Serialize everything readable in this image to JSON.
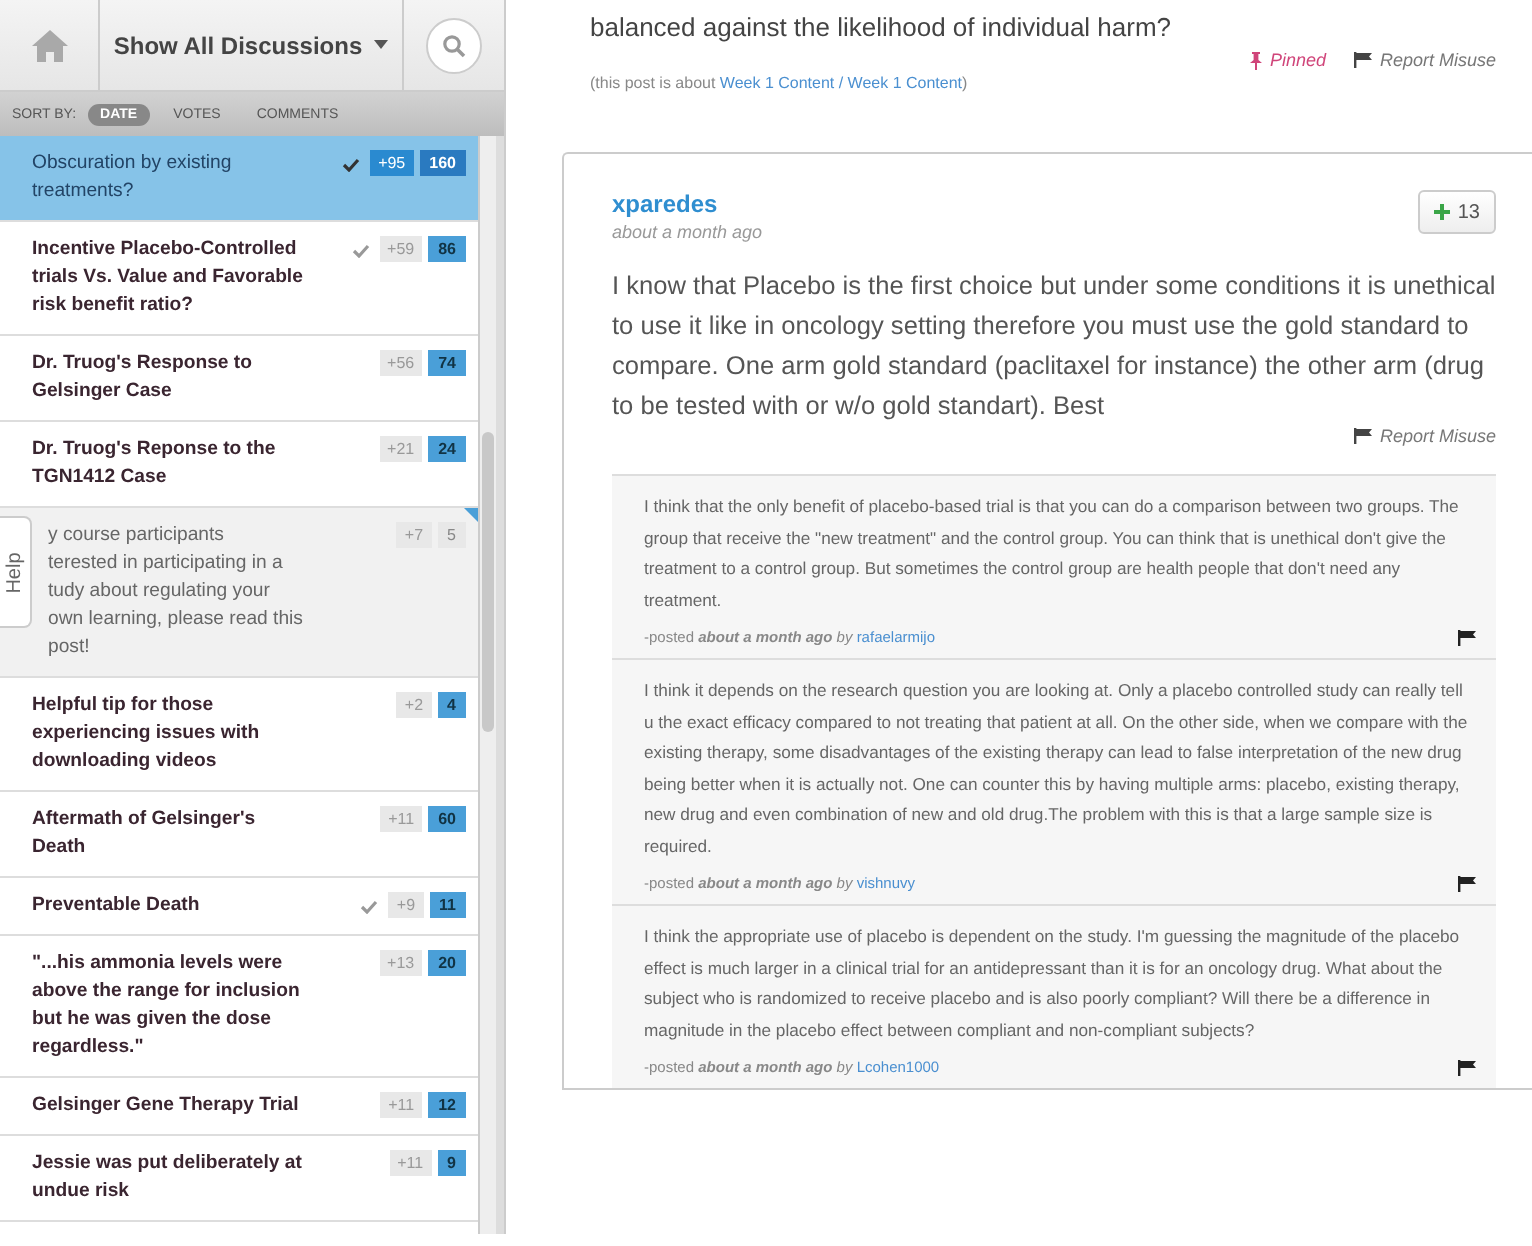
{
  "sidebar": {
    "filter_label": "Show All Discussions",
    "sort_label": "SORT BY:",
    "sort_options": [
      {
        "label": "DATE",
        "selected": true
      },
      {
        "label": "VOTES",
        "selected": false
      },
      {
        "label": "COMMENTS",
        "selected": false
      }
    ],
    "threads": [
      {
        "lines": [
          "Obscuration by existing",
          "treatments?"
        ],
        "followed": true,
        "votes": "+95",
        "comments": "160",
        "selected": true,
        "unread": false
      },
      {
        "lines": [
          "Incentive Placebo-Controlled",
          "trials Vs. Value and Favorable",
          "risk benefit ratio?"
        ],
        "followed": true,
        "votes": "+59",
        "comments": "86",
        "selected": false,
        "unread": false
      },
      {
        "lines": [
          "Dr. Truog's Response to",
          "Gelsinger Case"
        ],
        "followed": false,
        "votes": "+56",
        "comments": "74",
        "selected": false,
        "unread": false
      },
      {
        "lines": [
          "Dr. Truog's Reponse to the",
          "TGN1412 Case"
        ],
        "followed": false,
        "votes": "+21",
        "comments": "24",
        "selected": false,
        "unread": false
      },
      {
        "lines": [
          "y course participants",
          "terested in participating in a",
          "tudy about regulating your",
          "own learning, please read this",
          "post!"
        ],
        "followed": false,
        "votes": "+7",
        "comments": "5",
        "selected": false,
        "unread": true
      },
      {
        "lines": [
          "Helpful tip for those",
          "experiencing issues with",
          "downloading videos"
        ],
        "followed": false,
        "votes": "+2",
        "comments": "4",
        "selected": false,
        "unread": false
      },
      {
        "lines": [
          "Aftermath of Gelsinger's",
          "Death"
        ],
        "followed": false,
        "votes": "+11",
        "comments": "60",
        "selected": false,
        "unread": false
      },
      {
        "lines": [
          "Preventable Death"
        ],
        "followed": true,
        "votes": "+9",
        "comments": "11",
        "selected": false,
        "unread": false
      },
      {
        "lines": [
          "\"...his ammonia levels were",
          "above the range for inclusion",
          "but he was given the dose",
          "regardless.\""
        ],
        "followed": false,
        "votes": "+13",
        "comments": "20",
        "selected": false,
        "unread": false
      },
      {
        "lines": [
          "Gelsinger Gene Therapy Trial"
        ],
        "followed": false,
        "votes": "+11",
        "comments": "12",
        "selected": false,
        "unread": false
      },
      {
        "lines": [
          "Jessie was put deliberately at",
          "undue risk"
        ],
        "followed": false,
        "votes": "+11",
        "comments": "9",
        "selected": false,
        "unread": false
      }
    ],
    "help_tab": "Help"
  },
  "post": {
    "body_tail": "balanced against the likelihood of individual harm?",
    "pinned": "Pinned",
    "report": "Report Misuse",
    "about_prefix": "(this post is about",
    "about_link": "Week 1 Content / Week 1 Content",
    "about_suffix": ")"
  },
  "response": {
    "author": "xparedes",
    "time": "about a month ago",
    "votes": "13",
    "body": "I know that Placebo is the first choice but under some conditions it is unethical to use it like in oncology setting therefore you must use the gold standard to compare. One arm gold standard (paclitaxel for instance) the other arm (drug to be tested with or w/o gold standart). Best",
    "report": "Report Misuse",
    "comments": [
      {
        "body": "I think that the only benefit of placebo-based trial is that you can do a comparison between two groups. The group that receive the \"new treatment\" and the control group. You can think that is unethical don't give the treatment to a control group. But sometimes the control group are health people that don't need any treatment.",
        "posted": "-posted",
        "time": "about a month ago",
        "by": "by",
        "author": "rafaelarmijo"
      },
      {
        "body": "I think it depends on the research question you are looking at. Only a placebo controlled study can really tell u the exact efficacy compared to not treating that patient at all. On the other side, when we compare with the existing therapy, some disadvantages of the existing therapy can lead to false interpretation of the new drug being better when it is actually not. One can counter this by having multiple arms: placebo, existing therapy, new drug and even combination of new and old drug.The problem with this is that a large sample size is required.",
        "posted": "-posted",
        "time": "about a month ago",
        "by": "by",
        "author": "vishnuvy"
      },
      {
        "body": "I think the appropriate use of placebo is dependent on the study. I'm guessing the magnitude of the placebo effect is much larger in a clinical trial for an antidepressant than it is for an oncology drug. What about the subject who is randomized to receive placebo and is also poorly compliant? Will there be a difference in magnitude in the placebo effect between compliant and non-compliant subjects?",
        "posted": "-posted",
        "time": "about a month ago",
        "by": "by",
        "author": "Lcohen1000"
      }
    ]
  }
}
